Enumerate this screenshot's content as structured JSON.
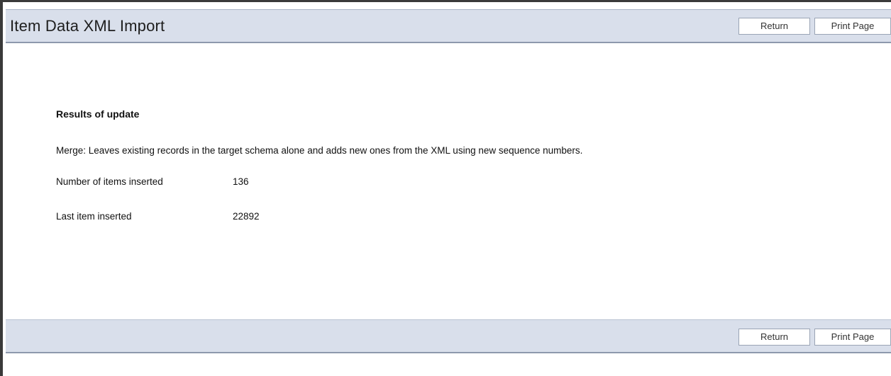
{
  "header": {
    "title": "Item Data XML Import",
    "return_label": "Return",
    "print_label": "Print Page"
  },
  "results": {
    "heading": "Results of update",
    "merge_description": "Merge: Leaves existing records in the target schema alone and adds new ones from the XML using new sequence numbers.",
    "items_inserted_label": "Number of items inserted",
    "items_inserted_value": "136",
    "last_item_label": "Last item inserted",
    "last_item_value": "22892"
  },
  "footer": {
    "return_label": "Return",
    "print_label": "Print Page"
  },
  "colors": {
    "bar_background": "#d9dfeb",
    "bar_border": "#8d99ad",
    "window_border": "#3a3a3a"
  }
}
